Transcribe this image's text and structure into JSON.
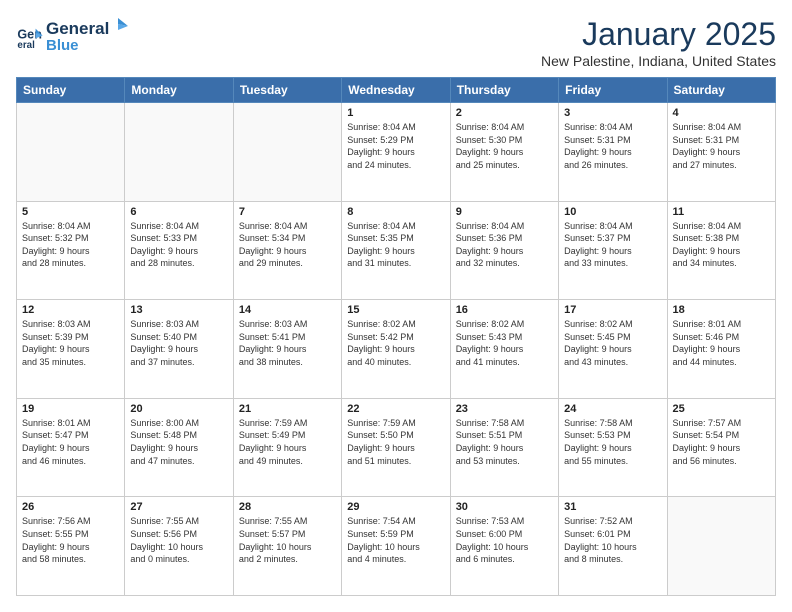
{
  "header": {
    "logo_line1": "General",
    "logo_line2": "Blue",
    "month": "January 2025",
    "location": "New Palestine, Indiana, United States"
  },
  "weekdays": [
    "Sunday",
    "Monday",
    "Tuesday",
    "Wednesday",
    "Thursday",
    "Friday",
    "Saturday"
  ],
  "weeks": [
    [
      {
        "day": "",
        "info": ""
      },
      {
        "day": "",
        "info": ""
      },
      {
        "day": "",
        "info": ""
      },
      {
        "day": "1",
        "info": "Sunrise: 8:04 AM\nSunset: 5:29 PM\nDaylight: 9 hours\nand 24 minutes."
      },
      {
        "day": "2",
        "info": "Sunrise: 8:04 AM\nSunset: 5:30 PM\nDaylight: 9 hours\nand 25 minutes."
      },
      {
        "day": "3",
        "info": "Sunrise: 8:04 AM\nSunset: 5:31 PM\nDaylight: 9 hours\nand 26 minutes."
      },
      {
        "day": "4",
        "info": "Sunrise: 8:04 AM\nSunset: 5:31 PM\nDaylight: 9 hours\nand 27 minutes."
      }
    ],
    [
      {
        "day": "5",
        "info": "Sunrise: 8:04 AM\nSunset: 5:32 PM\nDaylight: 9 hours\nand 28 minutes."
      },
      {
        "day": "6",
        "info": "Sunrise: 8:04 AM\nSunset: 5:33 PM\nDaylight: 9 hours\nand 28 minutes."
      },
      {
        "day": "7",
        "info": "Sunrise: 8:04 AM\nSunset: 5:34 PM\nDaylight: 9 hours\nand 29 minutes."
      },
      {
        "day": "8",
        "info": "Sunrise: 8:04 AM\nSunset: 5:35 PM\nDaylight: 9 hours\nand 31 minutes."
      },
      {
        "day": "9",
        "info": "Sunrise: 8:04 AM\nSunset: 5:36 PM\nDaylight: 9 hours\nand 32 minutes."
      },
      {
        "day": "10",
        "info": "Sunrise: 8:04 AM\nSunset: 5:37 PM\nDaylight: 9 hours\nand 33 minutes."
      },
      {
        "day": "11",
        "info": "Sunrise: 8:04 AM\nSunset: 5:38 PM\nDaylight: 9 hours\nand 34 minutes."
      }
    ],
    [
      {
        "day": "12",
        "info": "Sunrise: 8:03 AM\nSunset: 5:39 PM\nDaylight: 9 hours\nand 35 minutes."
      },
      {
        "day": "13",
        "info": "Sunrise: 8:03 AM\nSunset: 5:40 PM\nDaylight: 9 hours\nand 37 minutes."
      },
      {
        "day": "14",
        "info": "Sunrise: 8:03 AM\nSunset: 5:41 PM\nDaylight: 9 hours\nand 38 minutes."
      },
      {
        "day": "15",
        "info": "Sunrise: 8:02 AM\nSunset: 5:42 PM\nDaylight: 9 hours\nand 40 minutes."
      },
      {
        "day": "16",
        "info": "Sunrise: 8:02 AM\nSunset: 5:43 PM\nDaylight: 9 hours\nand 41 minutes."
      },
      {
        "day": "17",
        "info": "Sunrise: 8:02 AM\nSunset: 5:45 PM\nDaylight: 9 hours\nand 43 minutes."
      },
      {
        "day": "18",
        "info": "Sunrise: 8:01 AM\nSunset: 5:46 PM\nDaylight: 9 hours\nand 44 minutes."
      }
    ],
    [
      {
        "day": "19",
        "info": "Sunrise: 8:01 AM\nSunset: 5:47 PM\nDaylight: 9 hours\nand 46 minutes."
      },
      {
        "day": "20",
        "info": "Sunrise: 8:00 AM\nSunset: 5:48 PM\nDaylight: 9 hours\nand 47 minutes."
      },
      {
        "day": "21",
        "info": "Sunrise: 7:59 AM\nSunset: 5:49 PM\nDaylight: 9 hours\nand 49 minutes."
      },
      {
        "day": "22",
        "info": "Sunrise: 7:59 AM\nSunset: 5:50 PM\nDaylight: 9 hours\nand 51 minutes."
      },
      {
        "day": "23",
        "info": "Sunrise: 7:58 AM\nSunset: 5:51 PM\nDaylight: 9 hours\nand 53 minutes."
      },
      {
        "day": "24",
        "info": "Sunrise: 7:58 AM\nSunset: 5:53 PM\nDaylight: 9 hours\nand 55 minutes."
      },
      {
        "day": "25",
        "info": "Sunrise: 7:57 AM\nSunset: 5:54 PM\nDaylight: 9 hours\nand 56 minutes."
      }
    ],
    [
      {
        "day": "26",
        "info": "Sunrise: 7:56 AM\nSunset: 5:55 PM\nDaylight: 9 hours\nand 58 minutes."
      },
      {
        "day": "27",
        "info": "Sunrise: 7:55 AM\nSunset: 5:56 PM\nDaylight: 10 hours\nand 0 minutes."
      },
      {
        "day": "28",
        "info": "Sunrise: 7:55 AM\nSunset: 5:57 PM\nDaylight: 10 hours\nand 2 minutes."
      },
      {
        "day": "29",
        "info": "Sunrise: 7:54 AM\nSunset: 5:59 PM\nDaylight: 10 hours\nand 4 minutes."
      },
      {
        "day": "30",
        "info": "Sunrise: 7:53 AM\nSunset: 6:00 PM\nDaylight: 10 hours\nand 6 minutes."
      },
      {
        "day": "31",
        "info": "Sunrise: 7:52 AM\nSunset: 6:01 PM\nDaylight: 10 hours\nand 8 minutes."
      },
      {
        "day": "",
        "info": ""
      }
    ]
  ]
}
